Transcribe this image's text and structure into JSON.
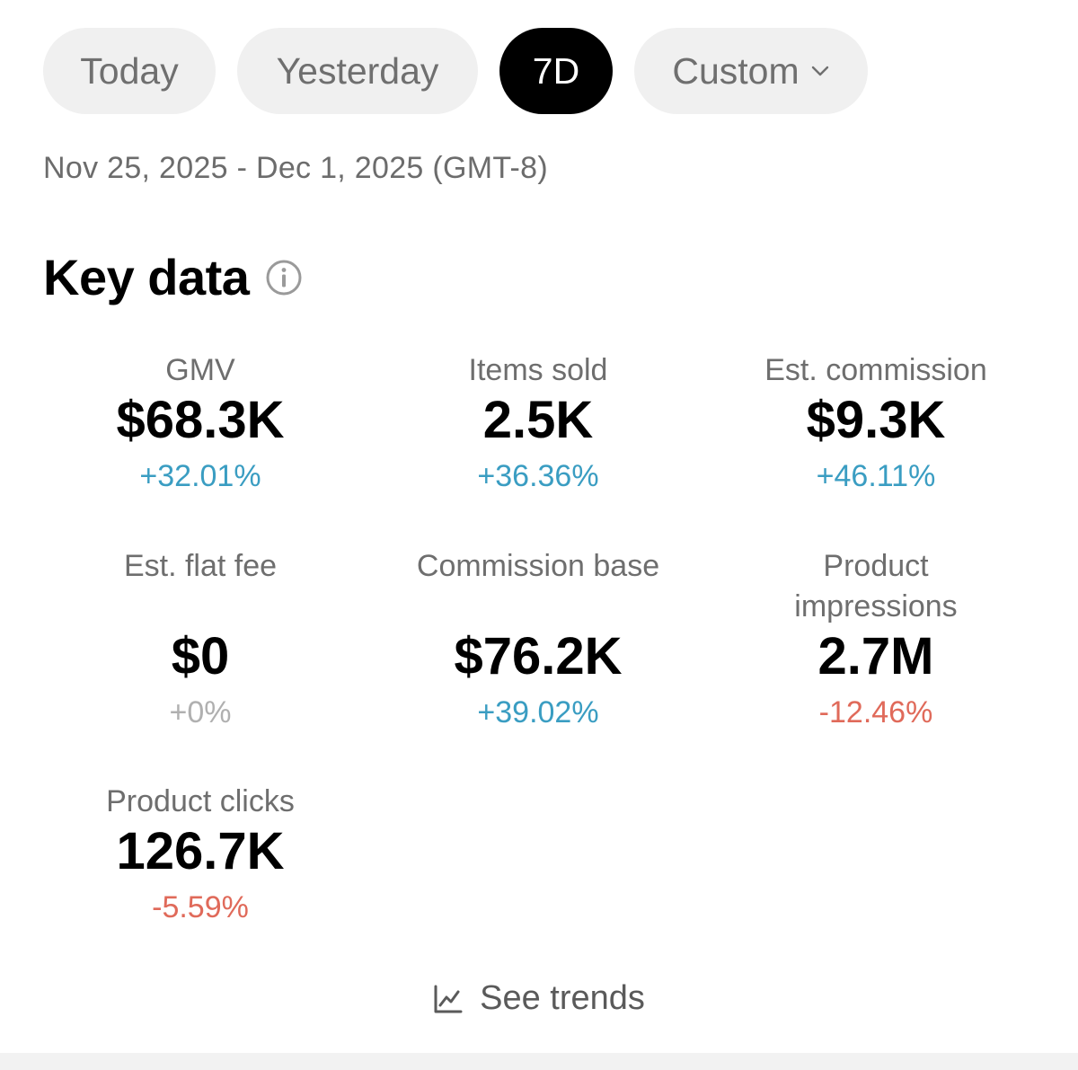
{
  "tabs": [
    {
      "label": "Today"
    },
    {
      "label": "Yesterday"
    },
    {
      "label": "7D"
    },
    {
      "label": "Custom"
    }
  ],
  "date_range": "Nov 25, 2025 - Dec 1, 2025 (GMT-8)",
  "section_title": "Key data",
  "metrics": [
    {
      "label": "GMV",
      "value": "$68.3K",
      "change": "+32.01%"
    },
    {
      "label": "Items sold",
      "value": "2.5K",
      "change": "+36.36%"
    },
    {
      "label": "Est. commission",
      "value": "$9.3K",
      "change": "+46.11%"
    },
    {
      "label": "Est. flat fee",
      "value": "$0",
      "change": "+0%"
    },
    {
      "label": "Commission base",
      "value": "$76.2K",
      "change": "+39.02%"
    },
    {
      "label": "Product impressions",
      "value": "2.7M",
      "change": "-12.46%"
    },
    {
      "label": "Product clicks",
      "value": "126.7K",
      "change": "-5.59%"
    }
  ],
  "see_trends_label": "See trends",
  "colors": {
    "positive": "#3a9dc2",
    "negative": "#e06a5a",
    "neutral": "#b0b0b0",
    "active_tab": "#000000"
  },
  "icons": {
    "info": "info-icon",
    "dropdown": "chevron-down-icon",
    "trend": "trend-chart-icon"
  }
}
